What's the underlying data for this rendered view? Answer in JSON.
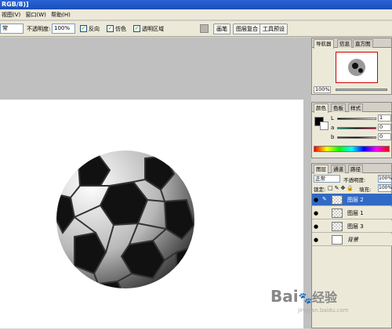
{
  "title": "RGB/8)]",
  "menu": [
    "视图(V)",
    "窗口(W)",
    "帮助(H)"
  ],
  "options": {
    "mode": "常",
    "opacity_label": "不透明度:",
    "opacity_value": "100%",
    "reverse": "反向",
    "dither": "仿色",
    "transparency": "透明区域",
    "tabs": [
      "画笔",
      "图层复合",
      "工具预设"
    ]
  },
  "navigator": {
    "tabs": [
      "导航器",
      "信息",
      "直方图"
    ],
    "zoom": "100%"
  },
  "color_panel": {
    "tabs": [
      "颜色",
      "色板",
      "样式"
    ],
    "channels": [
      {
        "label": "L",
        "value": "1"
      },
      {
        "label": "a",
        "value": "0"
      },
      {
        "label": "b",
        "value": "0"
      }
    ]
  },
  "layers_panel": {
    "tabs": [
      "图层",
      "通道",
      "路径"
    ],
    "blend_mode": "正常",
    "opacity_label": "不透明度:",
    "opacity_value": "100%",
    "lock_label": "锁定:",
    "fill_label": "填充:",
    "fill_value": "100%",
    "layers": [
      {
        "name": "图层 2",
        "active": true
      },
      {
        "name": "图层 1",
        "active": false
      },
      {
        "name": "图层 3",
        "active": false
      },
      {
        "name": "背景",
        "active": false
      }
    ]
  },
  "watermark": {
    "logo_text": "Bai",
    "text": "经验",
    "sub": "jingyan.baidu.com"
  },
  "colors": {
    "accent": "#316ac5",
    "titlebar": "#1a4fb8"
  }
}
